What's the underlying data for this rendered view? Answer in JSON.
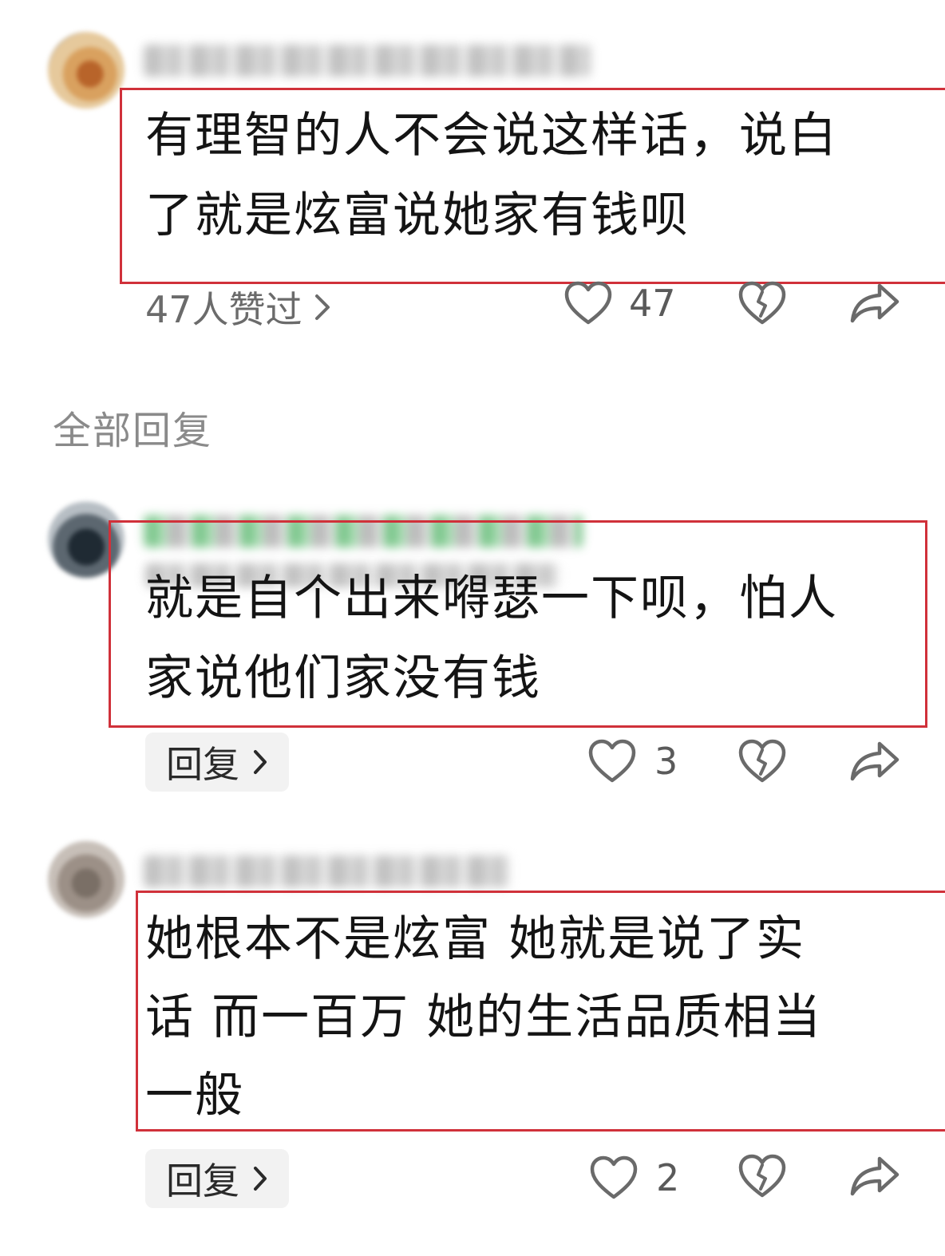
{
  "comment_main": {
    "text": "有理智的人不会说这样话，说白\n了就是炫富说她家有钱呗",
    "likes_summary": "47人赞过",
    "like_count": "47"
  },
  "section": {
    "title": "全部回复"
  },
  "replies": [
    {
      "text": "就是自个出来嘚瑟一下呗，怕人\n家说他们家没有钱",
      "reply_label": "回复",
      "like_count": "3"
    },
    {
      "text": "她根本不是炫富 她就是说了实\n话 而一百万 她的生活品质相当\n一般",
      "reply_label": "回复",
      "like_count": "2"
    }
  ],
  "icons": {
    "like": "heart-outline-icon",
    "dislike": "broken-heart-icon",
    "share": "share-arrow-icon",
    "chevron": "chevron-right-icon"
  },
  "colors": {
    "highlight_border": "#d0313a",
    "secondary_text": "#8a8a8a",
    "icon_stroke": "#6a6a6a"
  }
}
